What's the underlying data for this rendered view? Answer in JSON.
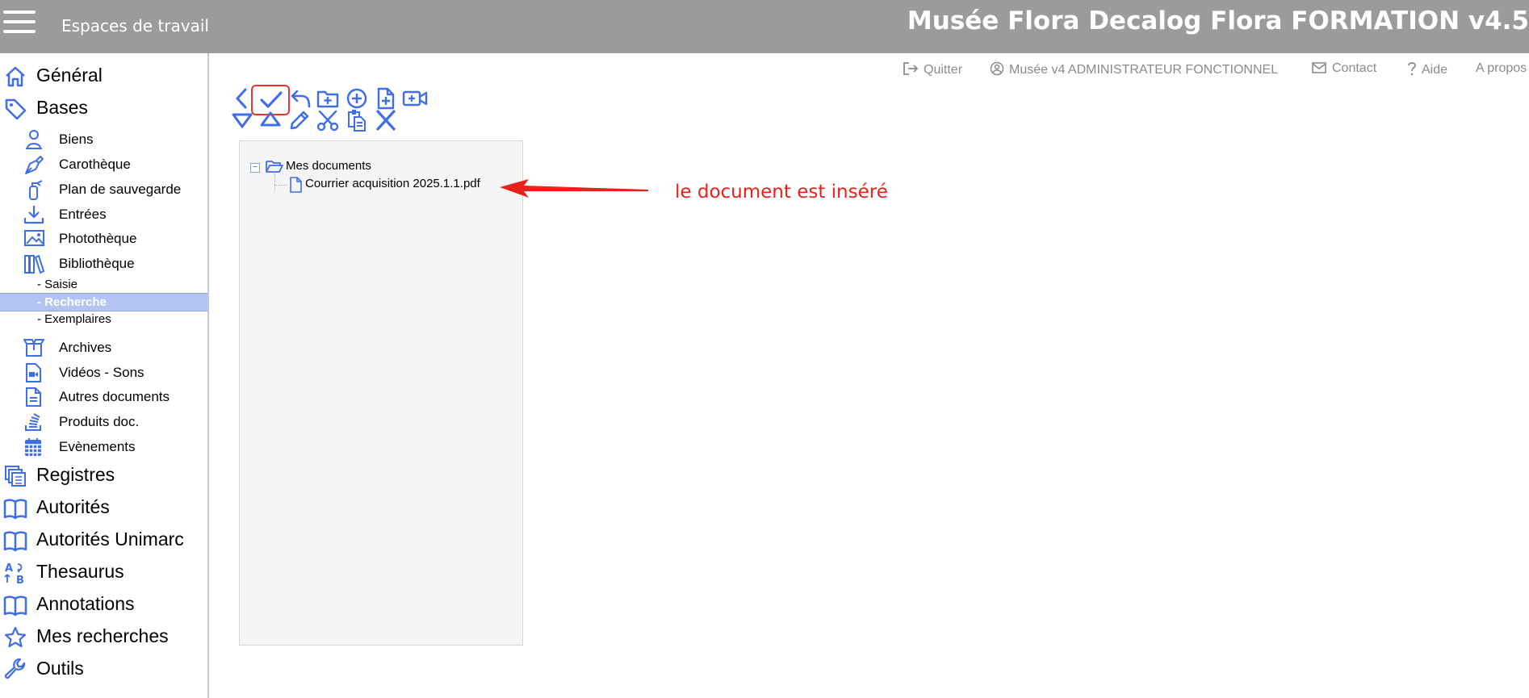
{
  "header": {
    "workspaces_label": "Espaces de travail",
    "app_title": "Musée Flora Decalog Flora FORMATION v4.5"
  },
  "top_menu": {
    "quit": "Quitter",
    "user": "Musée v4 ADMINISTRATEUR FONCTIONNEL",
    "contact": "Contact",
    "help": "Aide",
    "about": "A propos"
  },
  "sidebar": {
    "general": "Général",
    "bases": "Bases",
    "biens": "Biens",
    "carotheque": "Carothèque",
    "plan_sauvegarde": "Plan de sauvegarde",
    "entrees": "Entrées",
    "phototheque": "Photothèque",
    "bibliotheque": "Bibliothèque",
    "saisie": "- Saisie",
    "recherche": "- Recherche",
    "exemplaires": "- Exemplaires",
    "archives": "Archives",
    "videos_sons": "Vidéos - Sons",
    "autres_documents": "Autres documents",
    "produits_doc": "Produits doc.",
    "evenements": "Evènements",
    "registres": "Registres",
    "autorites": "Autorités",
    "autorites_unimarc": "Autorités Unimarc",
    "thesaurus": "Thesaurus",
    "annotations": "Annotations",
    "mes_recherches": "Mes recherches",
    "outils": "Outils"
  },
  "tree": {
    "root_label": "Mes documents",
    "child_label": "Courrier acquisition 2025.1.1.pdf"
  },
  "annotation": {
    "text": "le document est inséré",
    "color": "#e8221b"
  },
  "colors": {
    "topbar": "#9b9b9b",
    "icon_blue": "#3f6ee8",
    "active_item": "#b3c4f4",
    "highlight": "#e8332e"
  }
}
